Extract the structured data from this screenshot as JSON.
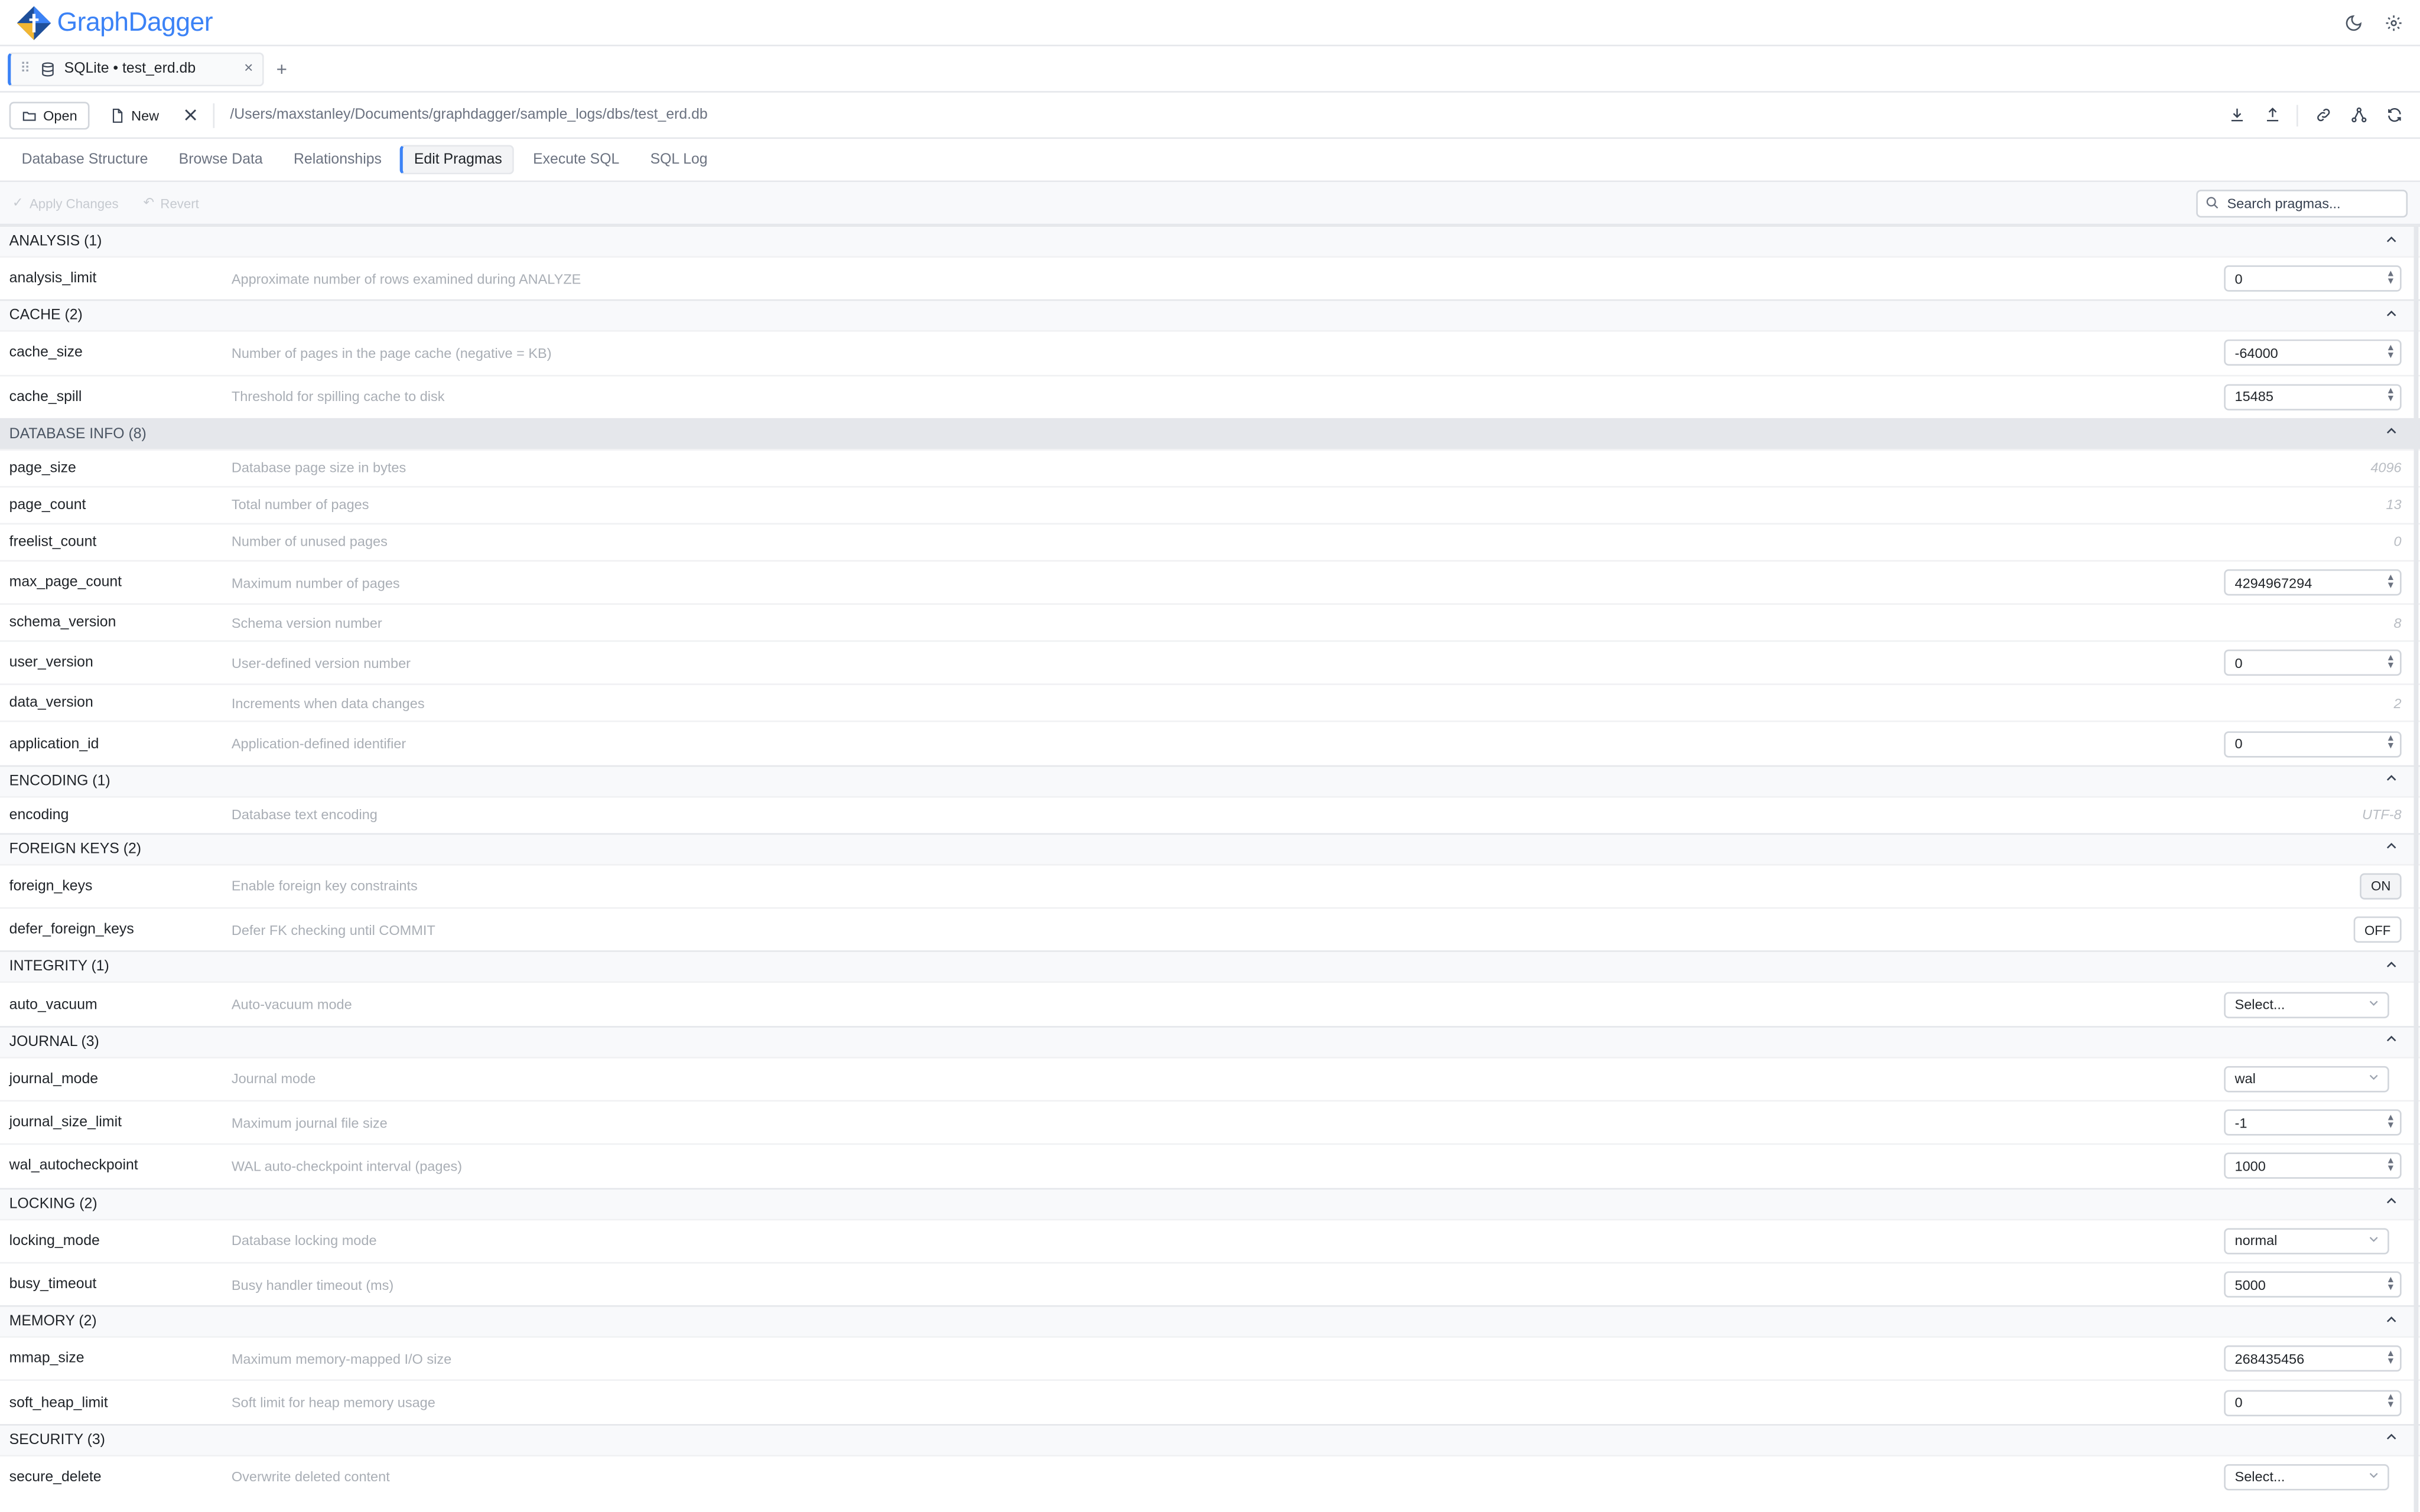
{
  "app": {
    "name": "GraphDagger"
  },
  "header": {
    "theme_icon": "moon-icon",
    "settings_icon": "gear-icon"
  },
  "file_tab": {
    "label": "SQLite • test_erd.db",
    "add_label": "+"
  },
  "toolbar": {
    "open_label": "Open",
    "new_label": "New",
    "path": "/Users/maxstanley/Documents/graphdagger/sample_logs/dbs/test_erd.db"
  },
  "nav_tabs": [
    {
      "label": "Database Structure"
    },
    {
      "label": "Browse Data"
    },
    {
      "label": "Relationships"
    },
    {
      "label": "Edit Pragmas",
      "active": true
    },
    {
      "label": "Execute SQL"
    },
    {
      "label": "SQL Log"
    }
  ],
  "actions": {
    "apply_label": "Apply Changes",
    "revert_label": "Revert",
    "search_placeholder": "Search pragmas..."
  },
  "sections": [
    {
      "title": "ANALYSIS (1)",
      "rows": [
        {
          "name": "analysis_limit",
          "desc": "Approximate number of rows examined during ANALYZE",
          "kind": "number",
          "value": "0"
        }
      ]
    },
    {
      "title": "CACHE (2)",
      "rows": [
        {
          "name": "cache_size",
          "desc": "Number of pages in the page cache (negative = KB)",
          "kind": "number",
          "value": "-64000"
        },
        {
          "name": "cache_spill",
          "desc": "Threshold for spilling cache to disk",
          "kind": "number",
          "value": "15485"
        }
      ]
    },
    {
      "title": "DATABASE INFO (8)",
      "highlight": true,
      "rows": [
        {
          "name": "page_size",
          "desc": "Database page size in bytes",
          "kind": "readonly",
          "value": "4096"
        },
        {
          "name": "page_count",
          "desc": "Total number of pages",
          "kind": "readonly",
          "value": "13"
        },
        {
          "name": "freelist_count",
          "desc": "Number of unused pages",
          "kind": "readonly",
          "value": "0"
        },
        {
          "name": "max_page_count",
          "desc": "Maximum number of pages",
          "kind": "number",
          "value": "4294967294"
        },
        {
          "name": "schema_version",
          "desc": "Schema version number",
          "kind": "readonly",
          "value": "8"
        },
        {
          "name": "user_version",
          "desc": "User-defined version number",
          "kind": "number",
          "value": "0"
        },
        {
          "name": "data_version",
          "desc": "Increments when data changes",
          "kind": "readonly",
          "value": "2"
        },
        {
          "name": "application_id",
          "desc": "Application-defined identifier",
          "kind": "number",
          "value": "0"
        }
      ]
    },
    {
      "title": "ENCODING (1)",
      "rows": [
        {
          "name": "encoding",
          "desc": "Database text encoding",
          "kind": "readonly",
          "value": "UTF-8"
        }
      ]
    },
    {
      "title": "FOREIGN KEYS (2)",
      "rows": [
        {
          "name": "foreign_keys",
          "desc": "Enable foreign key constraints",
          "kind": "toggle",
          "value": "ON"
        },
        {
          "name": "defer_foreign_keys",
          "desc": "Defer FK checking until COMMIT",
          "kind": "toggle",
          "value": "OFF"
        }
      ]
    },
    {
      "title": "INTEGRITY (1)",
      "rows": [
        {
          "name": "auto_vacuum",
          "desc": "Auto-vacuum mode",
          "kind": "select",
          "value": "Select..."
        }
      ]
    },
    {
      "title": "JOURNAL (3)",
      "rows": [
        {
          "name": "journal_mode",
          "desc": "Journal mode",
          "kind": "select",
          "value": "wal"
        },
        {
          "name": "journal_size_limit",
          "desc": "Maximum journal file size",
          "kind": "number",
          "value": "-1"
        },
        {
          "name": "wal_autocheckpoint",
          "desc": "WAL auto-checkpoint interval (pages)",
          "kind": "number",
          "value": "1000"
        }
      ]
    },
    {
      "title": "LOCKING (2)",
      "rows": [
        {
          "name": "locking_mode",
          "desc": "Database locking mode",
          "kind": "select",
          "value": "normal"
        },
        {
          "name": "busy_timeout",
          "desc": "Busy handler timeout (ms)",
          "kind": "number",
          "value": "5000"
        }
      ]
    },
    {
      "title": "MEMORY (2)",
      "rows": [
        {
          "name": "mmap_size",
          "desc": "Maximum memory-mapped I/O size",
          "kind": "number",
          "value": "268435456"
        },
        {
          "name": "soft_heap_limit",
          "desc": "Soft limit for heap memory usage",
          "kind": "number",
          "value": "0"
        }
      ]
    },
    {
      "title": "SECURITY (3)",
      "rows": [
        {
          "name": "secure_delete",
          "desc": "Overwrite deleted content",
          "kind": "select",
          "value": "Select..."
        }
      ]
    }
  ]
}
